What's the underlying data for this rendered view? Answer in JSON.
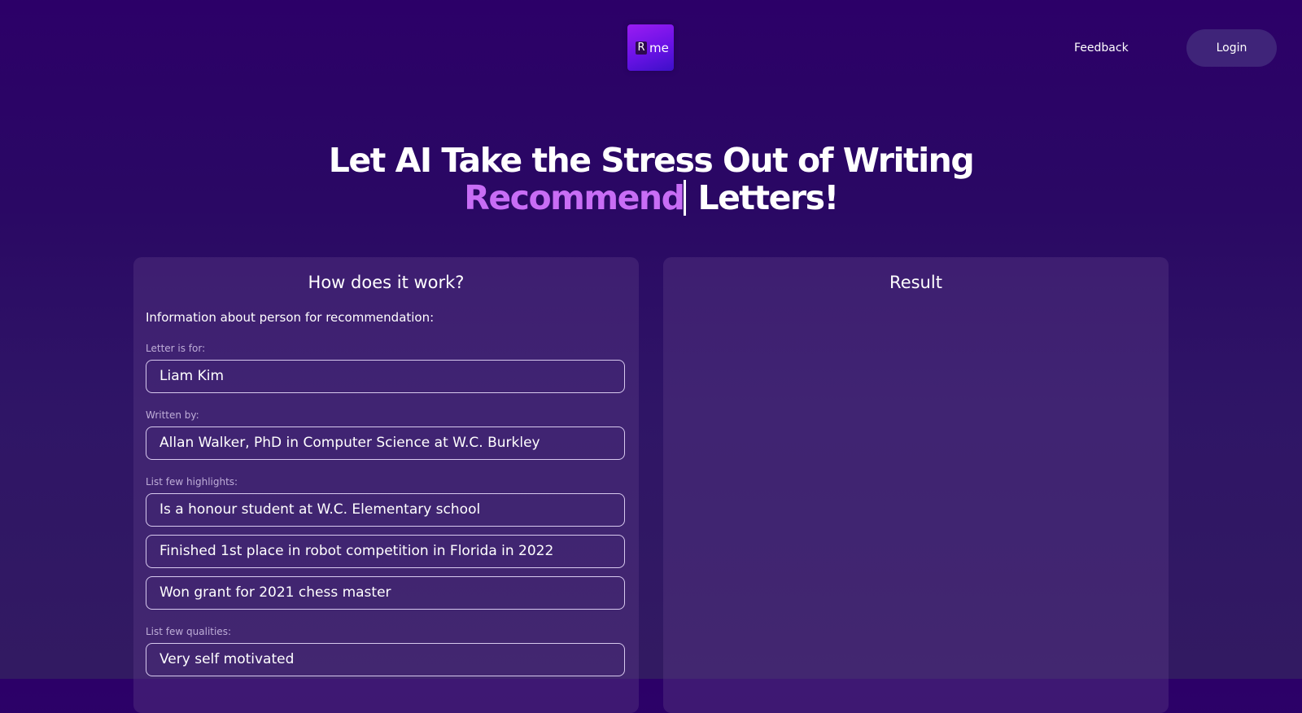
{
  "header": {
    "logo_r": "R",
    "logo_me": "me",
    "feedback_label": "Feedback",
    "login_label": "Login"
  },
  "hero": {
    "line1": "Let AI Take the Stress Out of Writing",
    "accent_word": "Recommend",
    "line2_rest": "Letters!"
  },
  "form_panel": {
    "title": "How does it work?",
    "section_label": "Information about person for recommendation:",
    "letter_for": {
      "label": "Letter is for:",
      "value": "Liam Kim"
    },
    "written_by": {
      "label": "Written by:",
      "value": "Allan Walker, PhD in Computer Science at W.C. Burkley"
    },
    "highlights": {
      "label": "List few highlights:",
      "items": [
        "Is a honour student at W.C. Elementary school",
        "Finished 1st place in robot competition in Florida in 2022",
        "Won grant for 2021 chess master"
      ]
    },
    "qualities": {
      "label": "List few qualities:",
      "items": [
        "Very self motivated"
      ]
    }
  },
  "result_panel": {
    "title": "Result"
  },
  "colors": {
    "background_top": "#2c0068",
    "accent": "#c86df5",
    "login_bg": "#3f2479",
    "panel_bg": "#3b2468"
  }
}
